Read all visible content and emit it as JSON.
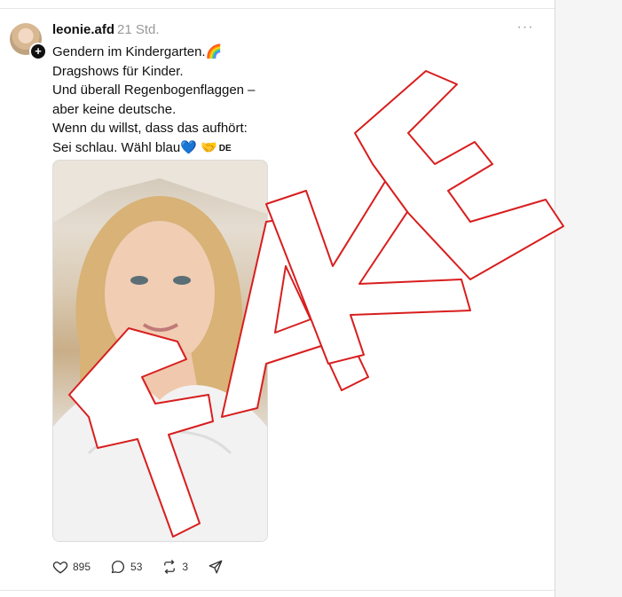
{
  "post": {
    "username": "leonie.afd",
    "timestamp": "21 Std.",
    "more_glyph": "···",
    "follow_glyph": "+",
    "lines": [
      "Gendern im Kindergarten.🌈",
      "Dragshows für Kinder.",
      "Und überall Regenbogenflaggen –",
      "aber keine deutsche.",
      "Wenn du willst, dass das aufhört:",
      "Sei schlau. Wähl blau💙 🤝"
    ],
    "flag_label": "DE"
  },
  "actions": {
    "like_count": "895",
    "comment_count": "53",
    "repost_count": "3"
  },
  "stamp": {
    "text": "FAKE",
    "outline_color": "#d81e1e"
  },
  "icons": {
    "like": "heart-icon",
    "comment": "comment-bubble-icon",
    "repost": "repost-icon",
    "share": "send-icon"
  }
}
